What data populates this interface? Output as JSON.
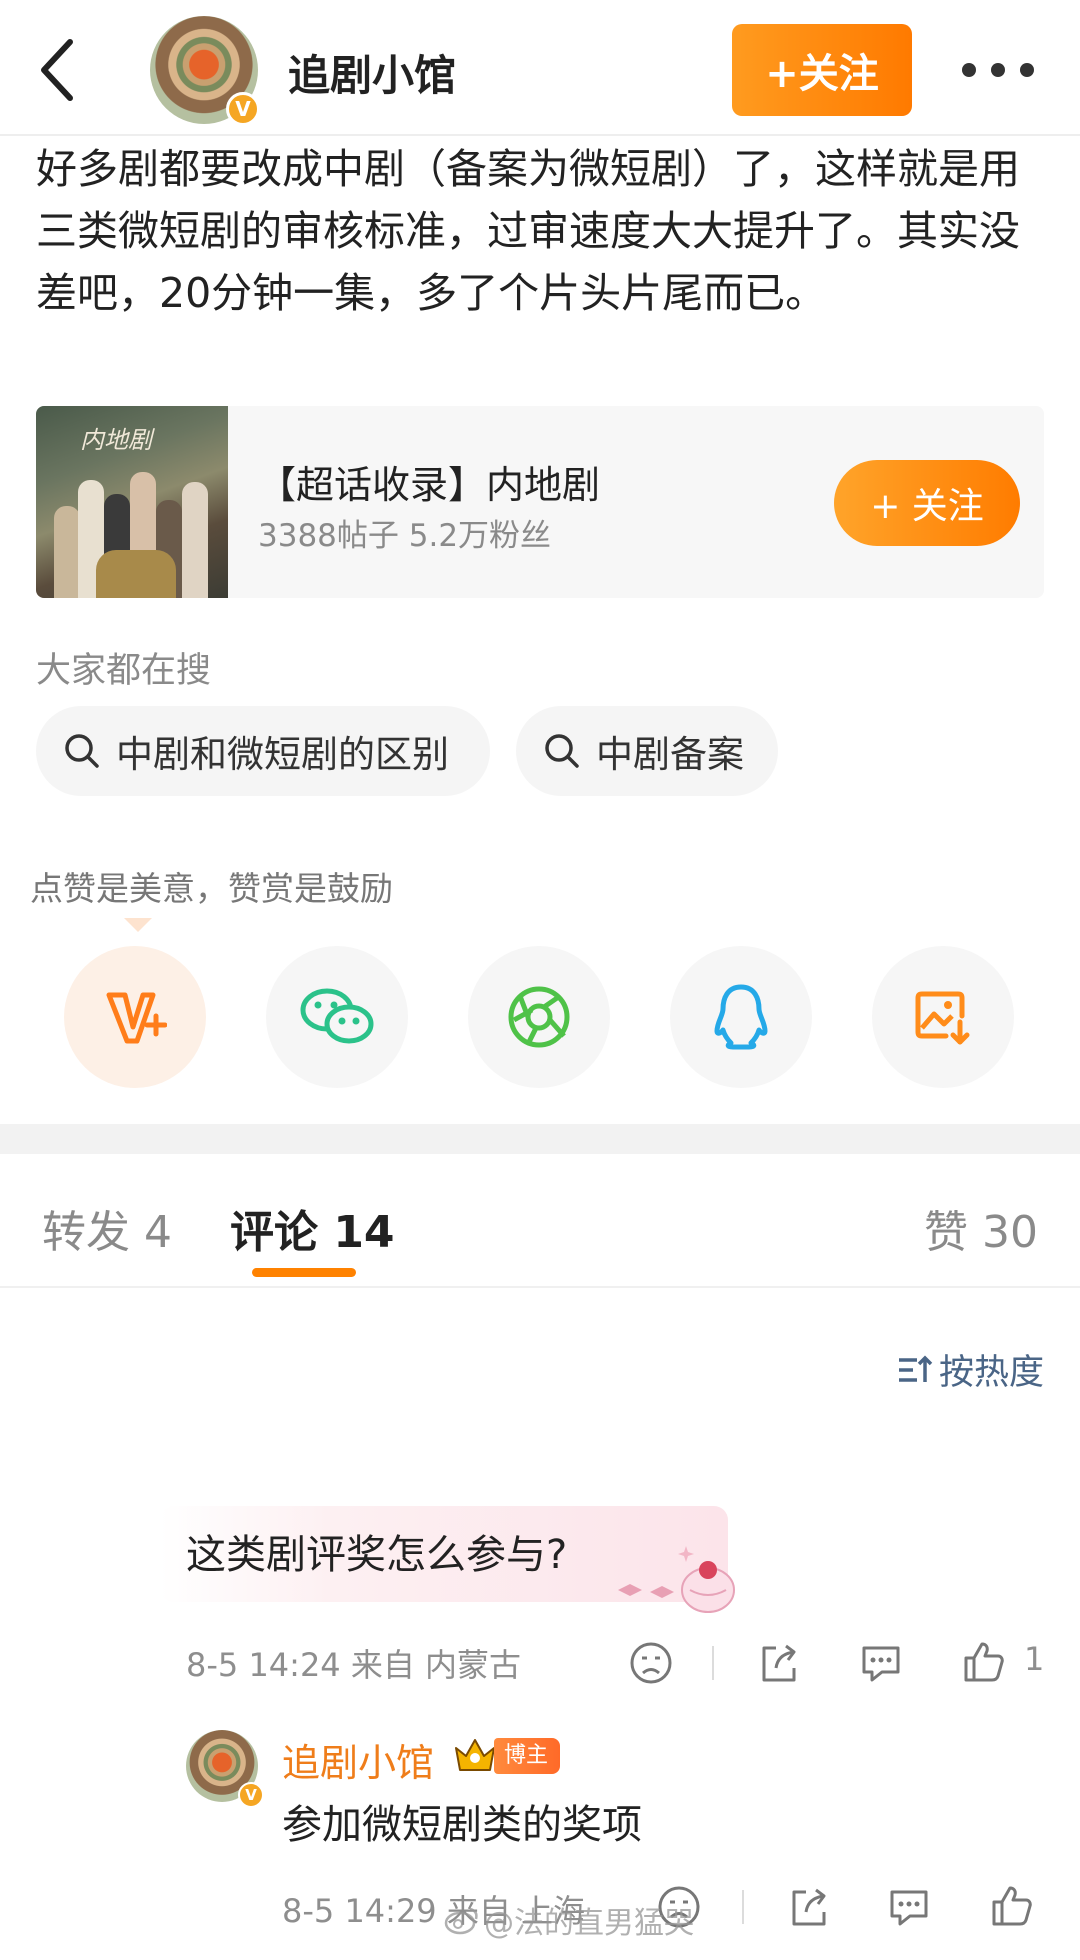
{
  "header": {
    "author_name": "追剧小馆",
    "verified_mark": "V",
    "follow_label": "+关注",
    "icons": {
      "back": "back-arrow-icon",
      "more": "more-dots-icon"
    }
  },
  "post": {
    "text": "好多剧都要改成中剧（备案为微短剧）了，这样就是用三类微短剧的审核标准，过审速度大大提升了。其实没差吧，20分钟一集，多了个片头片尾而已。"
  },
  "topic_card": {
    "thumb_text": "内地剧",
    "title": "【超话收录】内地剧",
    "meta": "3388帖子 5.2万粉丝",
    "follow_label": "+ 关注"
  },
  "search": {
    "heading": "大家都在搜",
    "chips": [
      "中剧和微短剧的区别",
      "中剧备案"
    ]
  },
  "reward": {
    "text": "点赞是美意，赞赏是鼓励",
    "share_icons": [
      "weibo-v-plus-icon",
      "wechat-icon",
      "moments-icon",
      "qq-icon",
      "save-image-icon"
    ]
  },
  "tabs": {
    "forward": "转发 4",
    "comments": "评论 14",
    "likes": "赞 30"
  },
  "sort_label": "按热度",
  "comment": {
    "text": "这类剧评奖怎么参与?",
    "meta": "8-5 14:24  来自 内蒙古",
    "like_count": "1"
  },
  "reply": {
    "author": "追剧小馆",
    "badge": "博主",
    "text": "参加微短剧类的奖项",
    "meta": "8-5 14:29  来自 上海"
  },
  "watermark": "@法的直男猛哭",
  "colors": {
    "accent_orange": "#ff8200",
    "reply_name": "#ef7d1a",
    "sort_blue": "#4a6586"
  }
}
